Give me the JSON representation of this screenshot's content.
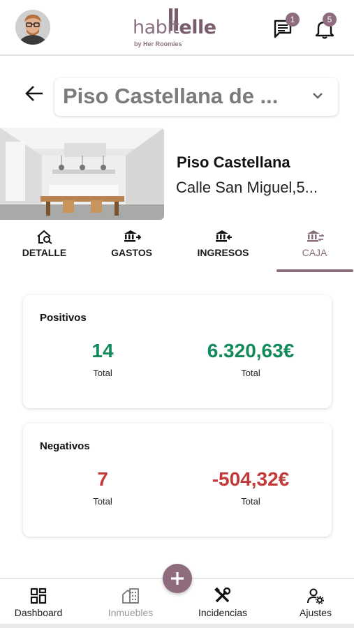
{
  "header": {
    "logo_text_light": "habit",
    "logo_text_bold": "elle",
    "logo_sub": "by Her Roomies",
    "messages_badge": "1",
    "notifications_badge": "5"
  },
  "property_selector": {
    "value": "Piso Castellana de ..."
  },
  "property": {
    "name": "Piso Castellana",
    "address": "Calle San Miguel,5..."
  },
  "tabs": [
    {
      "label": "DETALLE",
      "icon": "home-search-icon"
    },
    {
      "label": "GASTOS",
      "icon": "bank-out-icon"
    },
    {
      "label": "INGRESOS",
      "icon": "bank-in-icon"
    },
    {
      "label": "CAJA",
      "icon": "bank-transfer-icon",
      "active": true
    }
  ],
  "cards": {
    "positivos": {
      "title": "Positivos",
      "count": "14",
      "count_caption": "Total",
      "amount": "6.320,63€",
      "amount_caption": "Total"
    },
    "negativos": {
      "title": "Negativos",
      "count": "7",
      "count_caption": "Total",
      "amount": "-504,32€",
      "amount_caption": "Total"
    }
  },
  "bottom_nav": [
    {
      "label": "Dashboard",
      "icon": "dashboard-icon"
    },
    {
      "label": "Inmuebles",
      "icon": "building-icon",
      "active": true
    },
    {
      "label": "Incidencias",
      "icon": "tools-icon"
    },
    {
      "label": "Ajustes",
      "icon": "user-settings-icon"
    }
  ],
  "colors": {
    "brand": "#8e6b7d",
    "positive": "#138a5b",
    "negative": "#c43a3a"
  }
}
